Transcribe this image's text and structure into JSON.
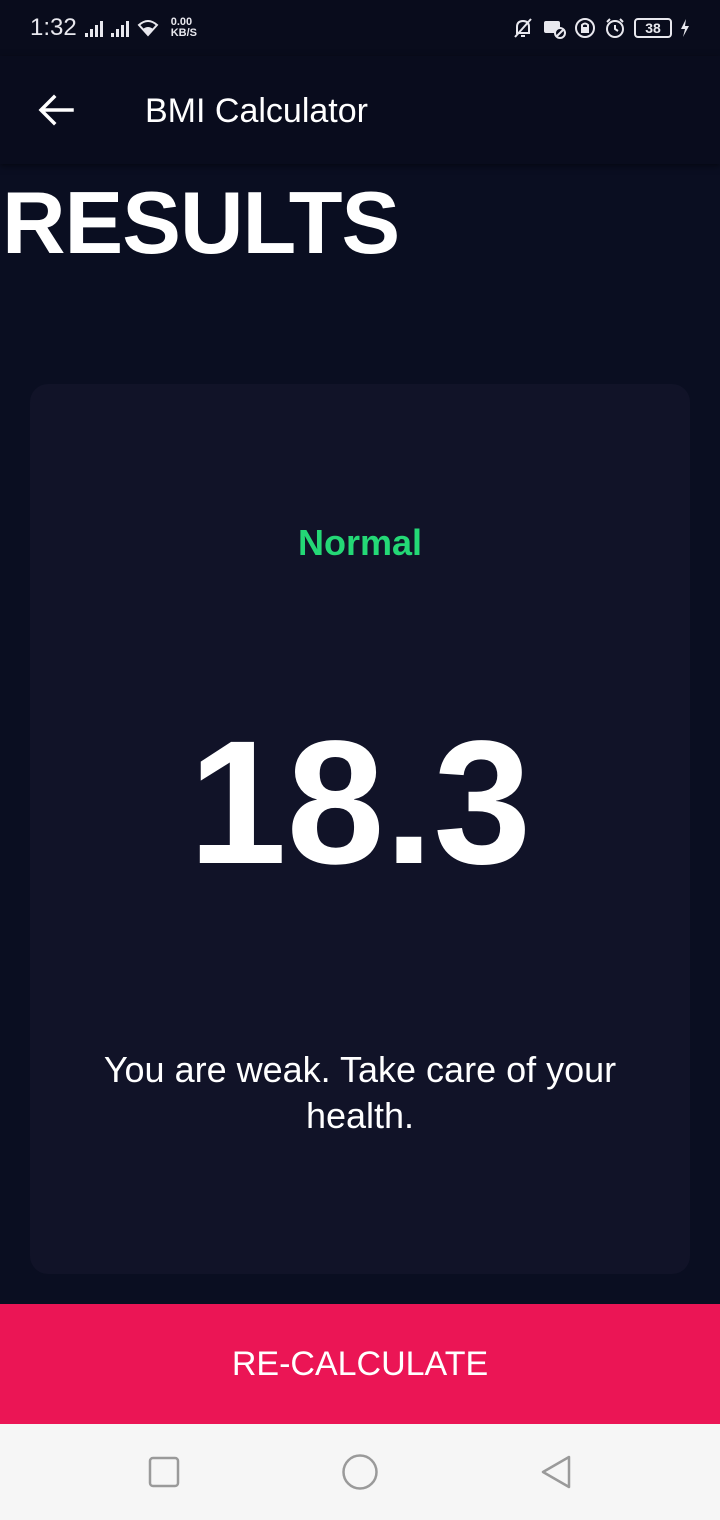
{
  "status_bar": {
    "time": "1:32",
    "net_speed_value": "0.00",
    "net_speed_unit": "KB/S",
    "battery": "38"
  },
  "app_bar": {
    "title": "BMI Calculator"
  },
  "page": {
    "heading": "RESULTS"
  },
  "result": {
    "status": "Normal",
    "bmi": "18.3",
    "message": "You are weak. Take care of your health."
  },
  "actions": {
    "recalculate_label": "RE-CALCULATE"
  },
  "colors": {
    "background": "#0a0e21",
    "card": "#111328",
    "status_green": "#24d876",
    "accent_pink": "#eb1555"
  }
}
